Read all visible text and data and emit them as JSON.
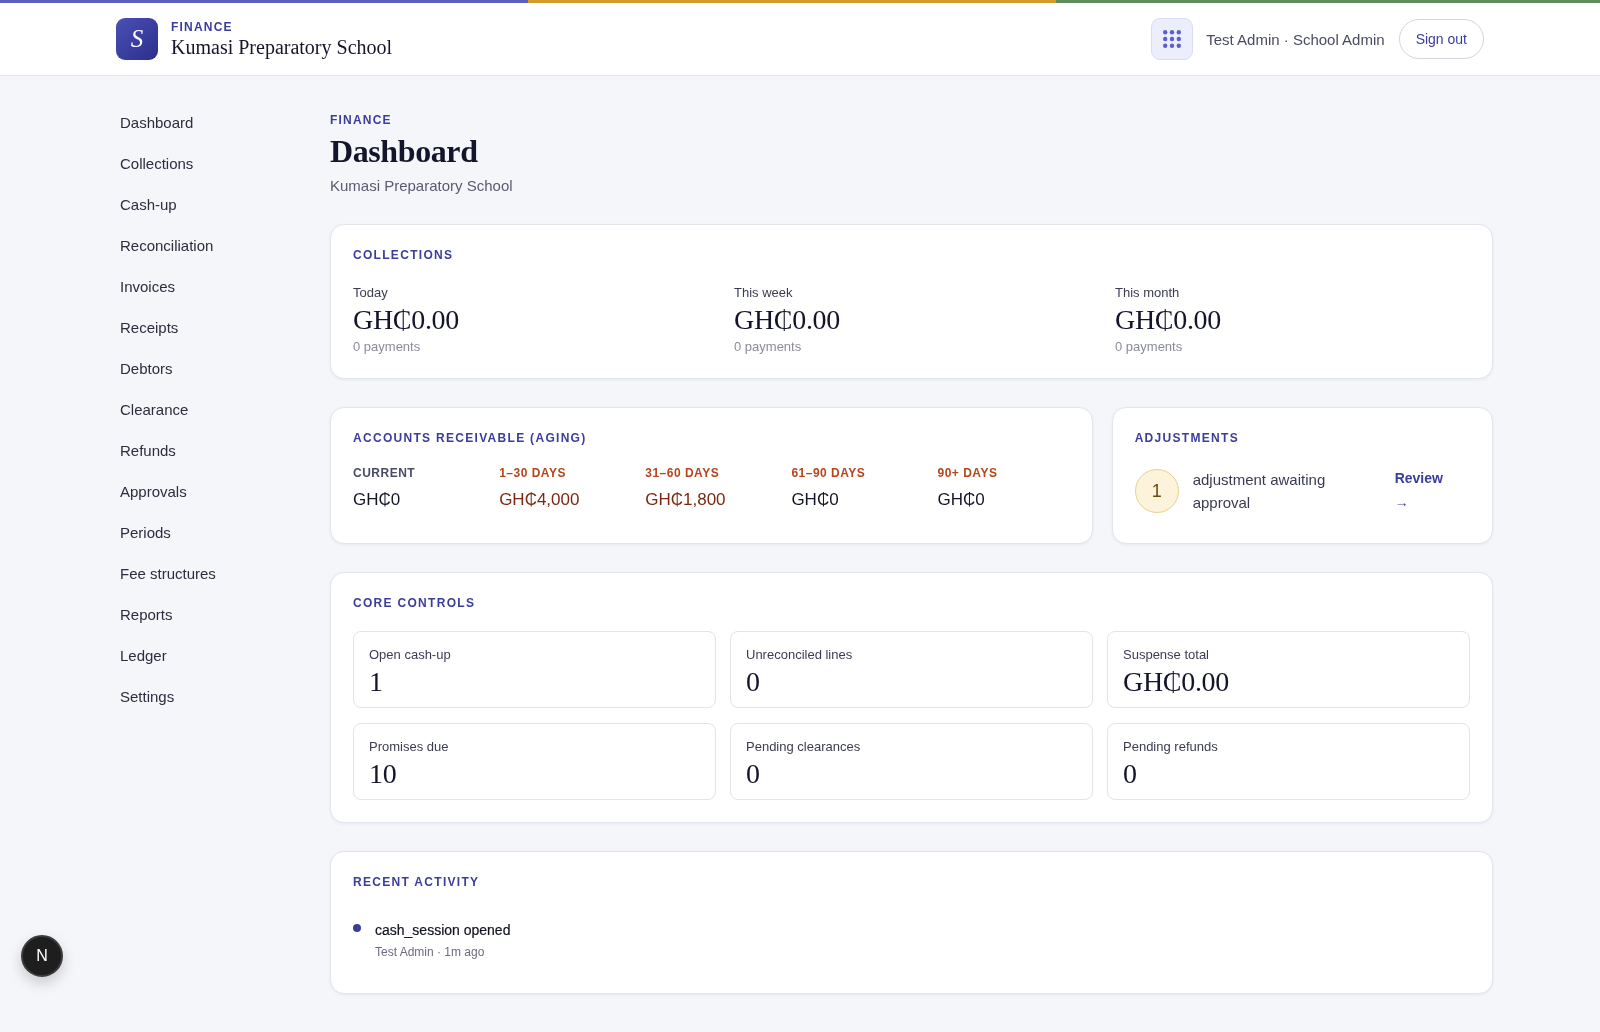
{
  "header": {
    "logo_letter": "S",
    "section": "FINANCE",
    "school": "Kumasi Preparatory School",
    "user": "Test Admin · School Admin",
    "sign_out": "Sign out"
  },
  "sidebar": {
    "items": [
      "Dashboard",
      "Collections",
      "Cash-up",
      "Reconciliation",
      "Invoices",
      "Receipts",
      "Debtors",
      "Clearance",
      "Refunds",
      "Approvals",
      "Periods",
      "Fee structures",
      "Reports",
      "Ledger",
      "Settings"
    ]
  },
  "page": {
    "eyebrow": "FINANCE",
    "title": "Dashboard",
    "subtitle": "Kumasi Preparatory School"
  },
  "collections": {
    "title": "COLLECTIONS",
    "periods": [
      {
        "label": "Today",
        "amount": "GH₵0.00",
        "count": "0 payments"
      },
      {
        "label": "This week",
        "amount": "GH₵0.00",
        "count": "0 payments"
      },
      {
        "label": "This month",
        "amount": "GH₵0.00",
        "count": "0 payments"
      }
    ]
  },
  "aging": {
    "title": "ACCOUNTS RECEIVABLE (AGING)",
    "buckets": [
      {
        "label": "CURRENT",
        "value": "GH₵0",
        "overdue": false,
        "alert": false
      },
      {
        "label": "1–30 DAYS",
        "value": "GH₵4,000",
        "overdue": true,
        "alert": true
      },
      {
        "label": "31–60 DAYS",
        "value": "GH₵1,800",
        "overdue": true,
        "alert": true
      },
      {
        "label": "61–90 DAYS",
        "value": "GH₵0",
        "overdue": true,
        "alert": false
      },
      {
        "label": "90+ DAYS",
        "value": "GH₵0",
        "overdue": true,
        "alert": false
      }
    ]
  },
  "adjustments": {
    "title": "ADJUSTMENTS",
    "count": "1",
    "text": "adjustment awaiting approval",
    "link": "Review →"
  },
  "core_controls": {
    "title": "CORE CONTROLS",
    "tiles": [
      {
        "label": "Open cash-up",
        "value": "1"
      },
      {
        "label": "Unreconciled lines",
        "value": "0"
      },
      {
        "label": "Suspense total",
        "value": "GH₵0.00"
      },
      {
        "label": "Promises due",
        "value": "10"
      },
      {
        "label": "Pending clearances",
        "value": "0"
      },
      {
        "label": "Pending refunds",
        "value": "0"
      }
    ]
  },
  "recent_activity": {
    "title": "RECENT ACTIVITY",
    "items": [
      {
        "event": "cash_session opened",
        "meta": "Test Admin · 1m ago"
      }
    ]
  },
  "dev_indicator": {
    "letter": "N"
  }
}
